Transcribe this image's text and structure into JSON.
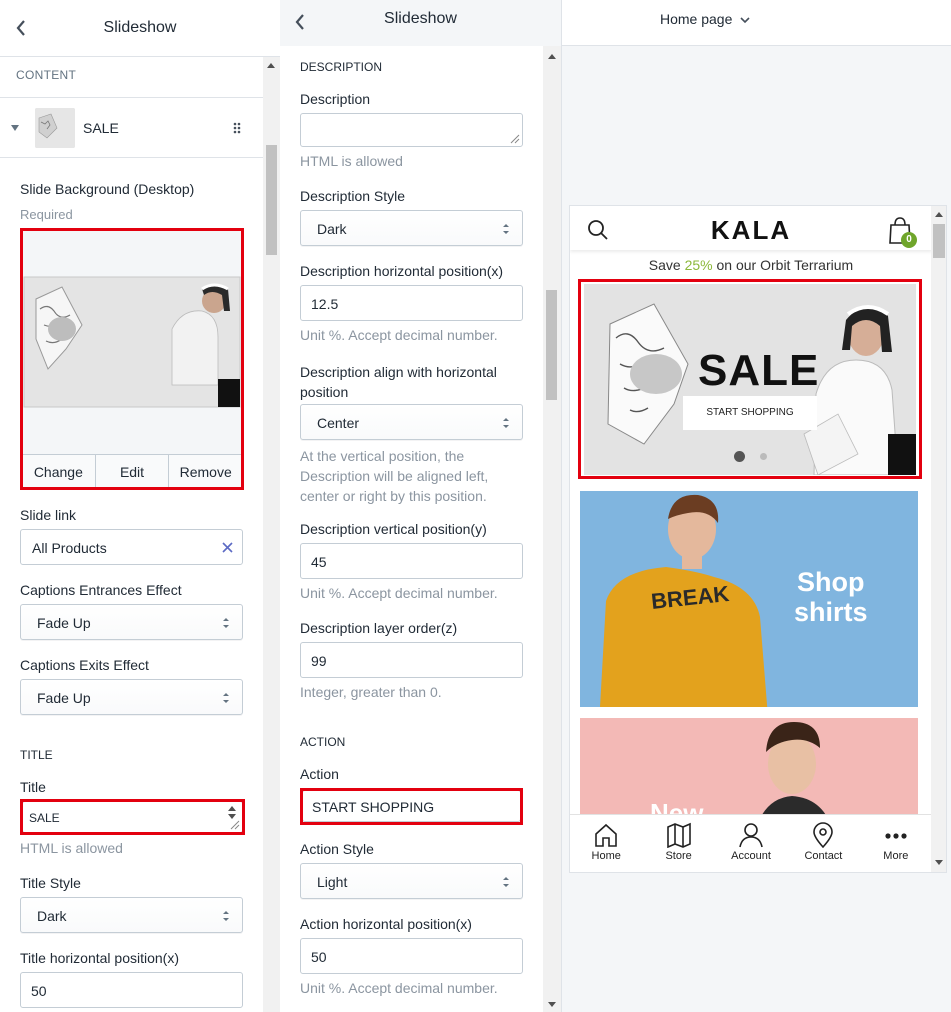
{
  "left": {
    "title": "Slideshow",
    "section": "CONTENT",
    "block_name": "SALE",
    "slide_bg_label": "Slide Background (Desktop)",
    "required": "Required",
    "image_buttons": {
      "change": "Change",
      "edit": "Edit",
      "remove": "Remove"
    },
    "slide_link_label": "Slide link",
    "slide_link_value": "All Products",
    "entrance_label": "Captions Entrances Effect",
    "entrance_value": "Fade Up",
    "exit_label": "Captions Exits Effect",
    "exit_value": "Fade Up",
    "title_section": "TITLE",
    "title_label": "Title",
    "title_value": "SALE",
    "title_help": "HTML is allowed",
    "title_style_label": "Title Style",
    "title_style_value": "Dark",
    "title_hpos_label": "Title horizontal position(x)",
    "title_hpos_value": "50"
  },
  "middle": {
    "title": "Slideshow",
    "description_section": "DESCRIPTION",
    "description_label": "Description",
    "description_value": "",
    "description_help": "HTML is allowed",
    "desc_style_label": "Description Style",
    "desc_style_value": "Dark",
    "desc_hpos_label": "Description horizontal position(x)",
    "desc_hpos_value": "12.5",
    "desc_hpos_help": "Unit %. Accept decimal number.",
    "desc_align_label": "Description align with horizontal position",
    "desc_align_value": "Center",
    "desc_align_help": "At the vertical position, the Description will be aligned left, center or right by this position.",
    "desc_vpos_label": "Description vertical position(y)",
    "desc_vpos_value": "45",
    "desc_vpos_help": "Unit %. Accept decimal number.",
    "desc_layer_label": "Description layer order(z)",
    "desc_layer_value": "99",
    "desc_layer_help": "Integer, greater than 0.",
    "action_section": "ACTION",
    "action_label": "Action",
    "action_value": "START SHOPPING",
    "action_style_label": "Action Style",
    "action_style_value": "Light",
    "action_hpos_label": "Action horizontal position(x)",
    "action_hpos_value": "50",
    "action_hpos_help": "Unit %. Accept decimal number."
  },
  "preview": {
    "page_selector": "Home page",
    "logo": "KALA",
    "cart_count": "0",
    "promo_prefix": "Save ",
    "promo_accent": "25%",
    "promo_suffix": " on our Orbit Terrarium",
    "slide_title": "SALE",
    "slide_button": "START SHOPPING",
    "banner2_line1": "Shop",
    "banner2_line2": "shirts",
    "banner3_text": "New",
    "tabs": [
      {
        "label": "Home",
        "icon": "home-icon"
      },
      {
        "label": "Store",
        "icon": "map-icon"
      },
      {
        "label": "Account",
        "icon": "user-icon"
      },
      {
        "label": "Contact",
        "icon": "location-pin-icon"
      },
      {
        "label": "More",
        "icon": "more-dots-icon"
      }
    ],
    "accent_color": "#8cb83a",
    "badge_color": "#6fa52b",
    "highlight_color": "#e3000f"
  }
}
